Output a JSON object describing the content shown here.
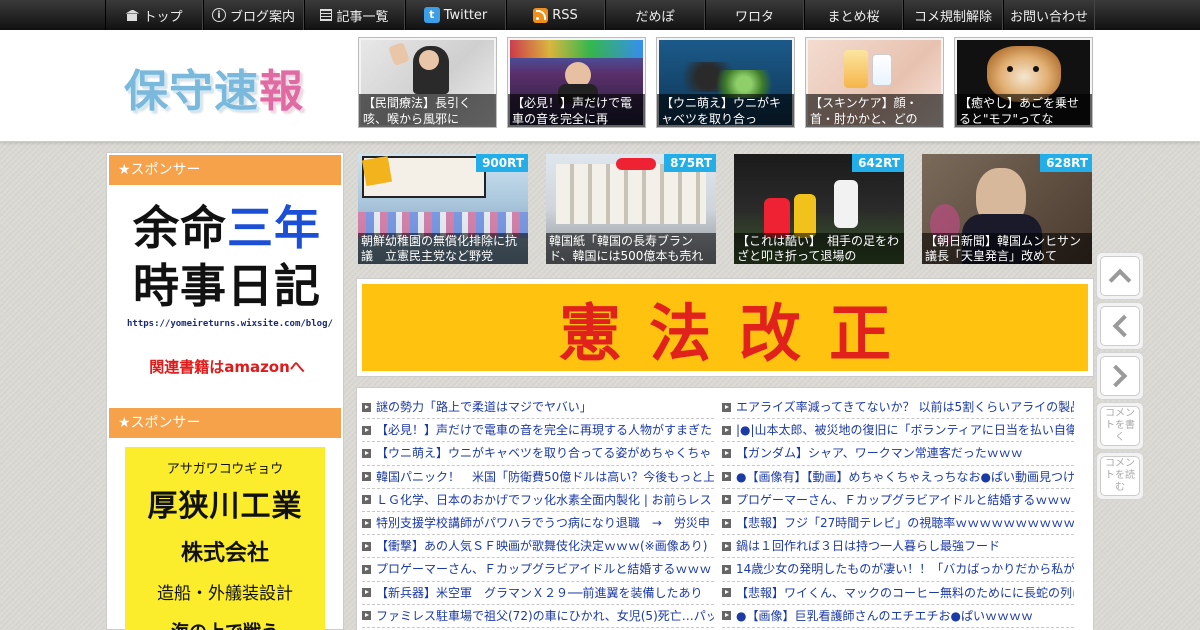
{
  "nav": [
    {
      "icon": "home-icon",
      "label": "トップ",
      "w": 98
    },
    {
      "icon": "info-icon",
      "label": "ブログ案内",
      "w": 101
    },
    {
      "icon": "list-icon",
      "label": "記事一覧",
      "w": 101
    },
    {
      "icon": "twitter-icon",
      "label": "Twitter",
      "w": 101
    },
    {
      "icon": "rss-icon",
      "label": "RSS",
      "w": 99
    },
    {
      "icon": "",
      "label": "だめぽ",
      "w": 100
    },
    {
      "icon": "",
      "label": "ワロタ",
      "w": 99
    },
    {
      "icon": "",
      "label": "まとめ桜",
      "w": 99
    },
    {
      "icon": "",
      "label": "コメ規制解除",
      "w": 100
    },
    {
      "icon": "",
      "label": "お問い合わせ",
      "w": 92
    }
  ],
  "logo": {
    "part1": "保守速",
    "part2": "報"
  },
  "header_thumbs": [
    {
      "caption": "【民間療法】長引く咳、喉から風邪に"
    },
    {
      "caption": "【必見！】声だけで電車の音を完全に再"
    },
    {
      "caption": "【ウニ萌え】ウニがキャベツを取り合っ"
    },
    {
      "caption": "【スキンケア】顔・首・肘かかと、どの"
    },
    {
      "caption": "【癒やし】あごを乗せると\"モフ\"ってな"
    }
  ],
  "sidebar": {
    "sponsor_label_1": "★スポンサー",
    "sponsor_label_2": "★スポンサー",
    "ad1": {
      "line1_a": "余命",
      "line1_b": "三年",
      "line2": "時事日記",
      "url": "https://yomeireturns.wixsite.com/blog/",
      "amazon": "関連書籍はamazonへ"
    },
    "ad2": {
      "kana": "アサガワコウギョウ",
      "name": "厚狭川工業",
      "corp": "株式会社",
      "service": "造船・外艤装設計",
      "tagline": "海の上で戦う"
    }
  },
  "rt_items": [
    {
      "badge": "900RT",
      "caption": "朝鮮幼稚園の無償化排除に抗議　立憲民主党など野党"
    },
    {
      "badge": "875RT",
      "caption": "韓国紙「韓国の長寿ブランド、韓国には500億本も売れ"
    },
    {
      "badge": "642RT",
      "caption": "【これは酷い】　相手の足をわざと叩き折って退場の"
    },
    {
      "badge": "628RT",
      "caption": "【朝日新聞】韓国ムンヒサン議長「天皇発言」改めて"
    }
  ],
  "banner": {
    "text": "憲法改正"
  },
  "news_left": [
    "謎の勢力「路上で柔道はマジでヤバい」",
    "【必見！】声だけで電車の音を完全に再現する人物がすまぎた",
    "【ウニ萌え】ウニがキャベツを取り合ってる姿がめちゃくちゃ",
    "韓国パニック！　米国「防衛費50億ドルは高い？今後もっと上",
    "ＬＧ化学、日本のおかげでフッ化水素全面内製化 | お前らレス",
    "特別支援学校講師がパワハラでうつ病になり退職　→　労災申",
    "【衝撃】あの人気ＳＦ映画が歌舞伎化決定ｗｗｗ(※画像あり)",
    "プロゲーマーさん、Ｆカップグラビアイドルと結婚するｗｗｗ",
    "【新兵器】米空軍　グラマンＸ２９──前進翼を装備したあり",
    "ファミレス駐車場で祖父(72)の車にひかれ、女児(5)死亡…パッ"
  ],
  "news_right": [
    "エアライズ率減ってきてないか？ 以前は5割くらいアライの製品",
    "|●|山本太郎、被災地の復旧に「ボランティアに日当を払い自衛",
    "【ガンダム】シャア、ワークマン常連客だったｗｗｗ",
    "●【画像有】【動画】めちゃくちゃえっちなお●ぱい動画見つけ",
    "プロゲーマーさん、Ｆカップグラビアイドルと結婚するｗｗｗ",
    "【悲報】フジ「27時間テレビ」の視聴率ｗｗｗｗｗｗｗｗｗｗ",
    "鍋は１回作れば３日は持つ一人暮らし最強フード",
    "14歳少女の発明したものが凄い！！「バカばっかりだから私が",
    "【悲報】ワイくん、マックのコーヒー無料のためにに長蛇の列に",
    "●【画像】巨乳看護師さんのエチエチお●ぱいｗｗｗｗ"
  ],
  "float_buttons": {
    "write_comment": "コメントを書く",
    "read_comment": "コメントを読む"
  },
  "colors": {
    "sponsor_orange": "#f6a24b",
    "link_blue": "#1c3aa6",
    "rt_badge": "#22aee8",
    "banner_bg": "#ffc20e",
    "banner_text": "#e1221c"
  }
}
